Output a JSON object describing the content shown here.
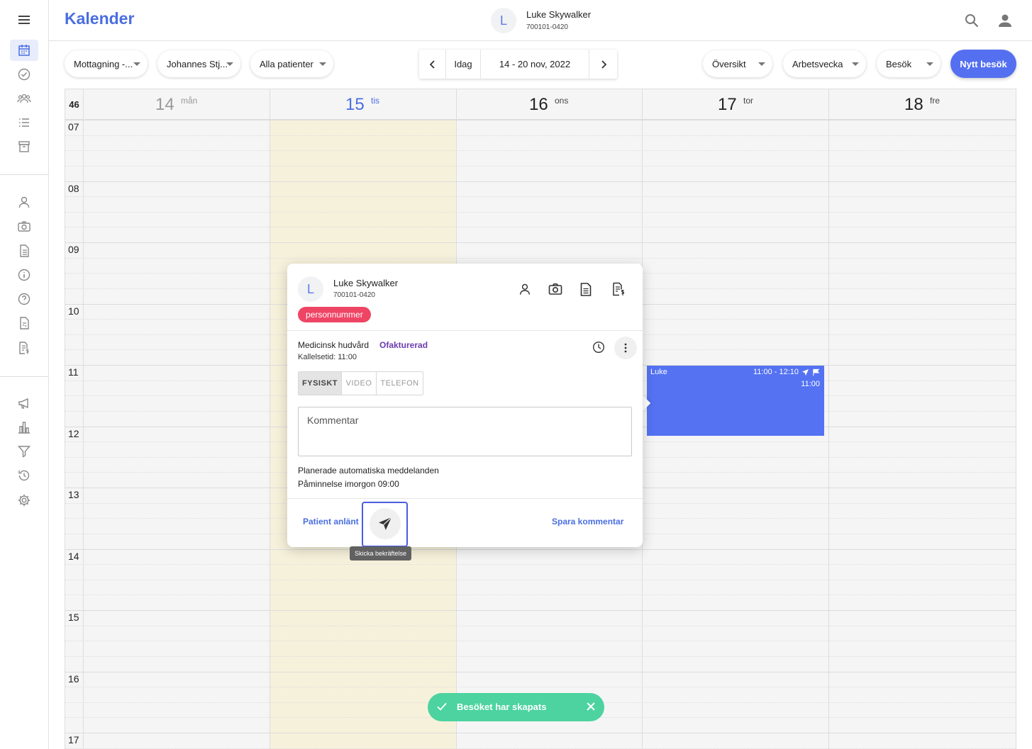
{
  "app": {
    "title": "Kalender"
  },
  "header": {
    "patient_initial": "L",
    "patient_name": "Luke Skywalker",
    "patient_pnr": "700101-0420"
  },
  "toolbar": {
    "filters": [
      {
        "label": "Mottagning -..."
      },
      {
        "label": "Johannes Stj..."
      },
      {
        "label": "Alla patienter"
      }
    ],
    "today_label": "Idag",
    "date_range": "14 - 20 nov, 2022",
    "view_selects": [
      {
        "label": "Översikt"
      },
      {
        "label": "Arbetsvecka"
      },
      {
        "label": "Besök"
      }
    ],
    "new_visit_label": "Nytt besök"
  },
  "calendar": {
    "week_number": "46",
    "days": [
      {
        "num": "14",
        "weekday": "mån",
        "state": "past"
      },
      {
        "num": "15",
        "weekday": "tis",
        "state": "today"
      },
      {
        "num": "16",
        "weekday": "ons",
        "state": "normal"
      },
      {
        "num": "17",
        "weekday": "tor",
        "state": "normal"
      },
      {
        "num": "18",
        "weekday": "fre",
        "state": "normal"
      }
    ],
    "hours": [
      "07",
      "08",
      "09",
      "10",
      "11",
      "12",
      "13",
      "14",
      "15",
      "16",
      "17"
    ],
    "event": {
      "name": "Luke",
      "time": "11:00 - 12:10",
      "start": "11:00",
      "color": "#5472f2"
    }
  },
  "popover": {
    "initial": "L",
    "name": "Luke Skywalker",
    "pnr": "700101-0420",
    "tag": "personnummer",
    "service": "Medicinsk hudvård",
    "status": "Ofakturerad",
    "kallelsetid": "Kallelsetid: 11:00",
    "visit_types": [
      "FYSISKT",
      "VIDEO",
      "TELEFON"
    ],
    "selected_visit_type": "FYSISKT",
    "comment_placeholder": "Kommentar",
    "planned_messages_label": "Planerade automatiska meddelanden",
    "reminder": "Påminnelse imorgon 09:00",
    "patient_arrived_label": "Patient anlänt",
    "save_comment_label": "Spara kommentar",
    "send_tooltip": "Skicka bekräftelse"
  },
  "toast": {
    "message": "Besöket har skapats",
    "color": "#4cd3a0"
  },
  "colors": {
    "accent": "#4a6ee0",
    "tag": "#ef4565",
    "status": "#6b3bb0",
    "today_bg": "#f6f1db"
  }
}
